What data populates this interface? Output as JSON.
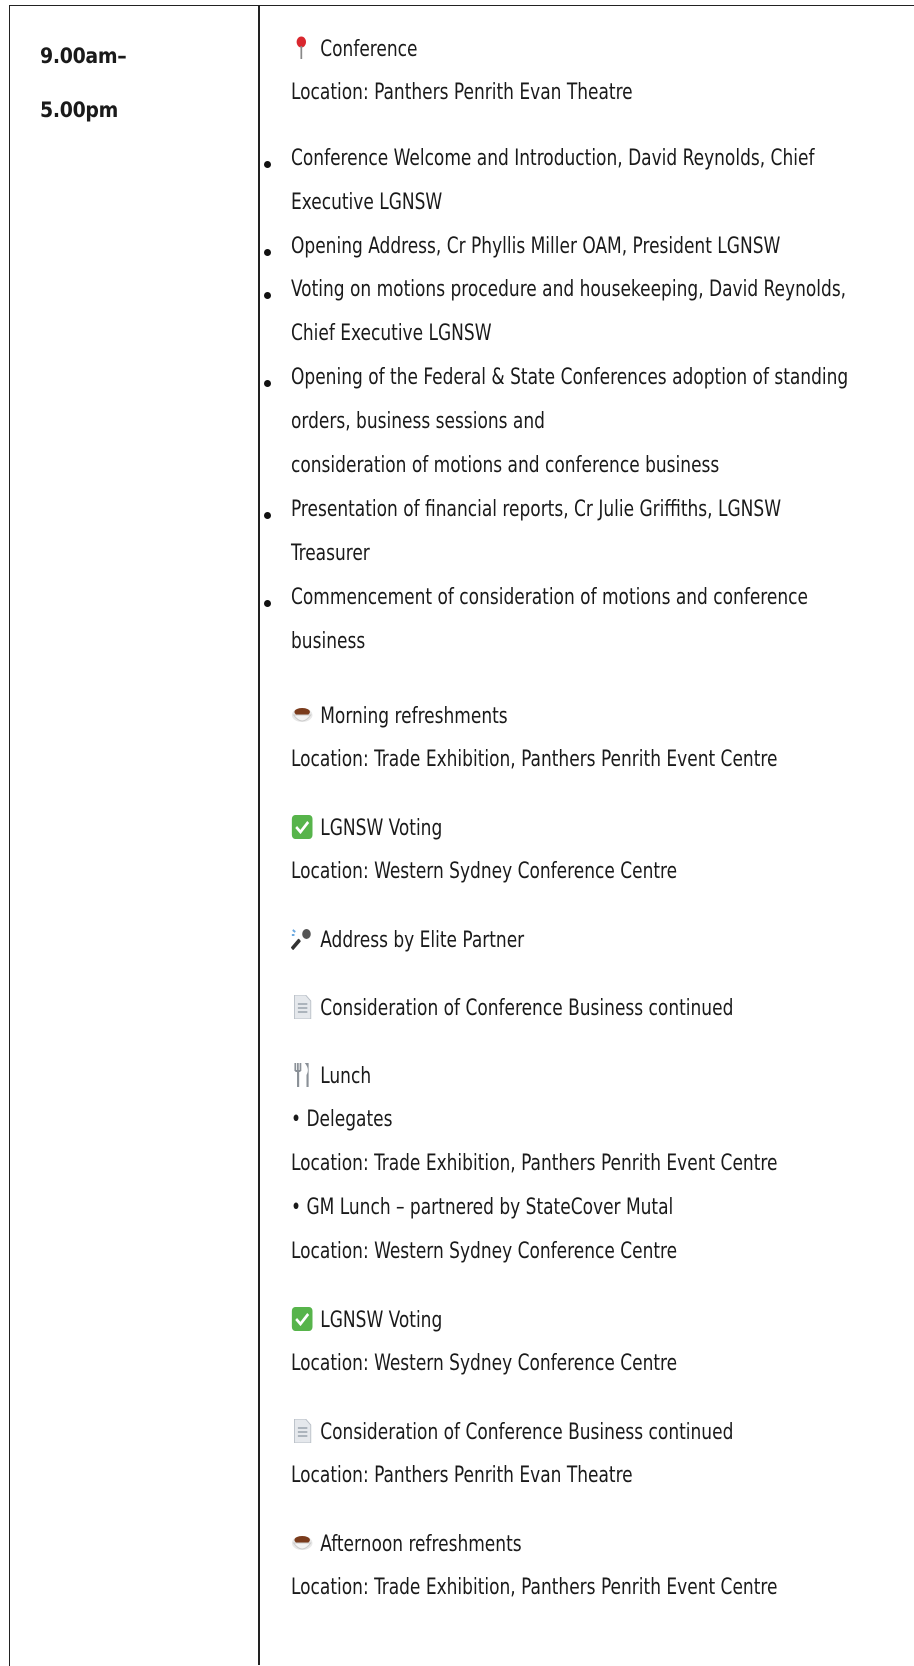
{
  "time": {
    "start": "9.00am–",
    "end": "5.00pm"
  },
  "conference": {
    "icon": "pushpin-icon",
    "title": "Conference",
    "location": "Location: Panthers Penrith Evan Theatre"
  },
  "agenda": [
    [
      "Conference Welcome and Introduction, David Reynolds, Chief",
      "Executive LGNSW"
    ],
    [
      "Opening Address, Cr Phyllis Miller OAM, President LGNSW"
    ],
    [
      "Voting on motions procedure and housekeeping, David Reynolds,",
      "Chief Executive LGNSW"
    ],
    [
      "Opening of the Federal & State Conferences adoption of standing",
      "orders, business sessions and",
      "consideration of motions and conference business"
    ],
    [
      "Presentation of financial reports, Cr Julie Griffiths, LGNSW",
      "Treasurer"
    ],
    [
      "Commencement of consideration of motions and conference",
      "business"
    ]
  ],
  "events": {
    "morning": {
      "icon": "coffee-icon",
      "title": "Morning refreshments",
      "location": "Location: Trade Exhibition, Panthers Penrith Event Centre"
    },
    "voting1": {
      "icon": "check-icon",
      "title": "LGNSW Voting",
      "location": "Location: Western Sydney Conference Centre"
    },
    "partner": {
      "icon": "microphone-icon",
      "title": "Address by Elite Partner"
    },
    "business1": {
      "icon": "document-icon",
      "title": "Consideration of Conference Business continued"
    },
    "lunch": {
      "icon": "cutlery-icon",
      "title": "Lunch",
      "delegates": "• Delegates",
      "delegates_location": "Location: Trade Exhibition, Panthers Penrith Event Centre",
      "gm": "• GM Lunch – partnered by StateCover Mutal",
      "gm_location": "Location: Western Sydney Conference Centre"
    },
    "voting2": {
      "icon": "check-icon",
      "title": "LGNSW Voting",
      "location": "Location: Western Sydney Conference Centre"
    },
    "business2": {
      "icon": "document-icon",
      "title": "Consideration of Conference Business continued",
      "location": "Location: Panthers Penrith Evan Theatre"
    },
    "afternoon": {
      "icon": "coffee-icon",
      "title": "Afternoon refreshments",
      "location": "Location: Trade Exhibition, Panthers Penrith Event Centre"
    }
  },
  "colors": {
    "check_green": "#57b44b",
    "pin_red": "#d9272e",
    "coffee_brown": "#7a3b1c"
  }
}
